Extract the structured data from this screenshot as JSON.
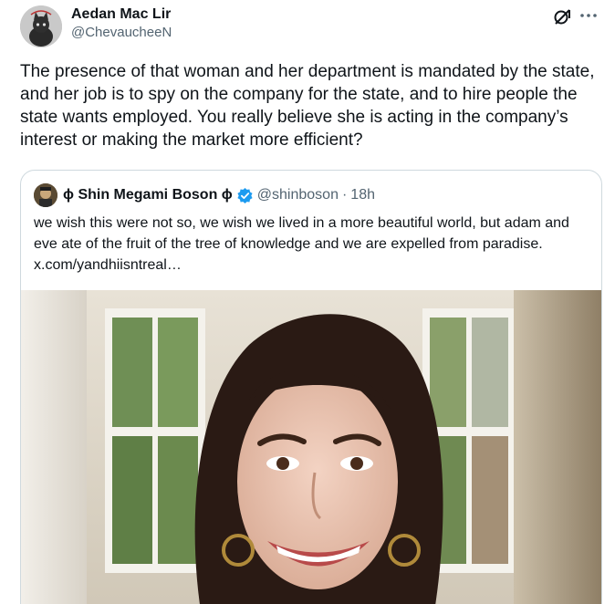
{
  "post": {
    "author_name": "Aedan Mac Lir",
    "author_handle": "@ChevaucheeN",
    "text": "The presence of that woman and her department is mandated by the state, and her job is to spy on the company for the state, and to hire people the state wants employed. You really believe she is acting in the company’s interest or making the market more efficient?",
    "icons": {
      "grok": "grok-icon",
      "more": "more-icon"
    }
  },
  "quote": {
    "author_name": "ɸ Shin Megami Boson ɸ",
    "verified": true,
    "verified_color": "#1d9bf0",
    "author_handle": "@shinboson",
    "separator": "·",
    "time": "18h",
    "text": "we wish this were not so, we wish we lived in a more beautiful world, but adam and eve ate of the fruit of the tree of knowledge and we are expelled from paradise.",
    "link": "x.com/yandhiisntreal…"
  },
  "colors": {
    "text_primary": "#0f1419",
    "text_secondary": "#536471",
    "border": "#cfd9de",
    "accent": "#1d9bf0"
  }
}
